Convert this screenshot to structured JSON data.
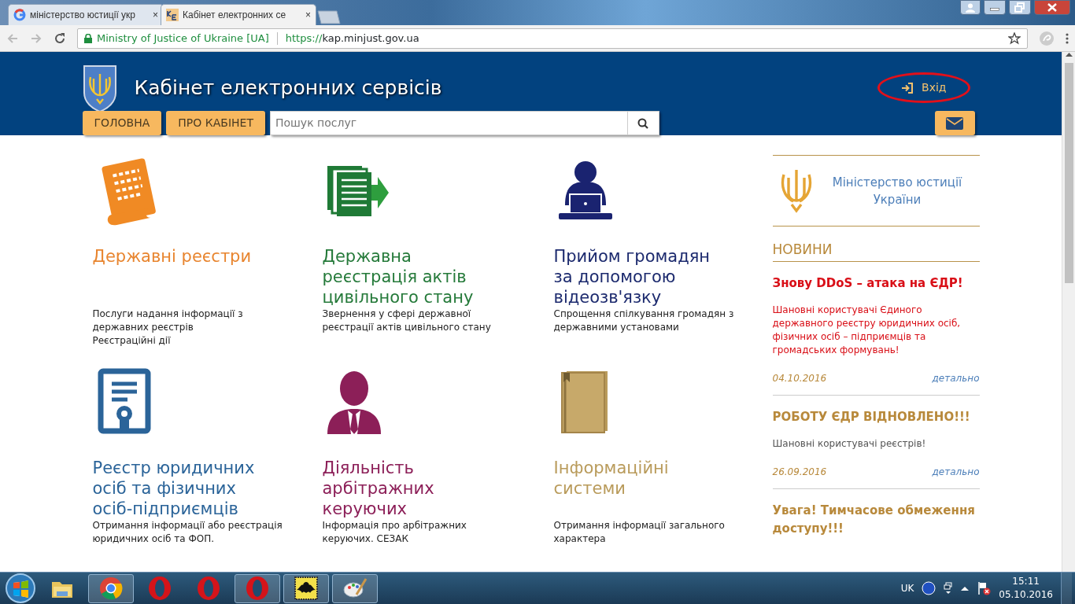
{
  "browser": {
    "tabs": [
      {
        "title": "міністерство юстиції укр",
        "selected": false
      },
      {
        "title": "Кабінет електронних се",
        "selected": true
      }
    ],
    "close_glyph": "×",
    "security_label": "Ministry of Justice of Ukraine [UA]",
    "url_scheme": "https://",
    "url_host": "kap.minjust.gov.ua"
  },
  "header": {
    "title": "Кабінет електронних сервісів",
    "login": "Вхід"
  },
  "nav": [
    {
      "label": "ГОЛОВНА"
    },
    {
      "label": "ПРО КАБІНЕТ"
    }
  ],
  "search": {
    "placeholder": "Пошук послуг"
  },
  "services": [
    {
      "title": "Державні реєстри",
      "color": "#e8852f",
      "lines": [
        "Послуги надання інформації з державних реєстрів",
        "Реєстраційні дії"
      ]
    },
    {
      "title": "Державна реєстрація актів цивільного стану",
      "color": "#257a3a",
      "lines": [
        "Звернення у сфері державної реєстрації актів цивільного стану"
      ]
    },
    {
      "title": "Прийом громадян за допомогою відеозв'язку",
      "color": "#1c2a6e",
      "lines": [
        "Спрощення спілкування громадян з державними установами"
      ]
    },
    {
      "title": "Реєстр юридичних осіб та фізичних осіб-підприємців",
      "color": "#2b6499",
      "lines": [
        "Отримання інформації або реєстрація юридичних осіб та ФОП."
      ]
    },
    {
      "title": "Діяльність арбітражних керуючих",
      "color": "#8c1f58",
      "lines": [
        "Інформація про арбітражних керуючих. СЕЗАК"
      ]
    },
    {
      "title": "Інформаційні системи",
      "color": "#b99b5b",
      "lines": [
        "Отримання інформації загального характера"
      ]
    }
  ],
  "sidebar": {
    "ministry": "Міністерство юстиції України",
    "news_heading": "НОВИНИ",
    "news": [
      {
        "title": "Знову DDoS – атака на ЄДР!",
        "urgent": true,
        "text": "Шановні користувачі Єдиного державного реєстру юридичних осіб, фізичних осіб – підприємців та громадських формувань!",
        "date": "04.10.2016",
        "more": "детально"
      },
      {
        "title": "РОБОТУ ЄДР ВІДНОВЛЕНО!!!",
        "urgent": false,
        "text": "Шановні користувачі реєстрів!",
        "date": "26.09.2016",
        "more": "детально"
      },
      {
        "title": "Увага! Тимчасове обмеження доступу!!!",
        "urgent": false
      }
    ]
  },
  "taskbar": {
    "apps": [
      {
        "kind": "folder",
        "selected": false
      },
      {
        "kind": "chrome",
        "selected": true
      },
      {
        "kind": "opera",
        "selected": false
      },
      {
        "kind": "opera",
        "selected": false
      },
      {
        "kind": "opera",
        "selected": true
      },
      {
        "kind": "bat",
        "selected": true
      },
      {
        "kind": "paint",
        "selected": true
      }
    ],
    "language": "UK",
    "time": "15:11",
    "date": "05.10.2016"
  }
}
